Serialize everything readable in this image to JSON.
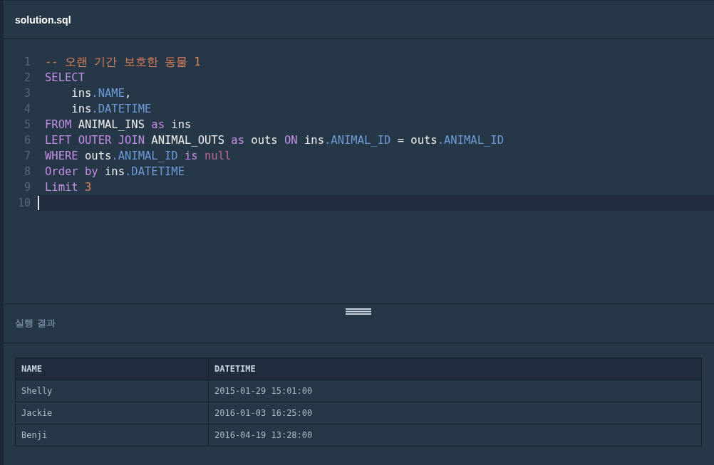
{
  "editor": {
    "filename": "solution.sql",
    "lines": [
      {
        "number": "1",
        "current": false,
        "tokens": [
          {
            "kind": "comment",
            "text": "-- 오랜 기간 보호한 동물 "
          },
          {
            "kind": "number",
            "text": "1"
          }
        ]
      },
      {
        "number": "2",
        "current": false,
        "tokens": [
          {
            "kind": "keyword",
            "text": "SELECT"
          }
        ]
      },
      {
        "number": "3",
        "current": false,
        "tokens": [
          {
            "kind": "plain",
            "text": "    ins"
          },
          {
            "kind": "property",
            "text": ".NAME"
          },
          {
            "kind": "plain",
            "text": ","
          }
        ]
      },
      {
        "number": "4",
        "current": false,
        "tokens": [
          {
            "kind": "plain",
            "text": "    ins"
          },
          {
            "kind": "property",
            "text": ".DATETIME"
          }
        ]
      },
      {
        "number": "5",
        "current": false,
        "tokens": [
          {
            "kind": "keyword",
            "text": "FROM"
          },
          {
            "kind": "plain",
            "text": " ANIMAL_INS "
          },
          {
            "kind": "keyword",
            "text": "as"
          },
          {
            "kind": "plain",
            "text": " ins"
          }
        ]
      },
      {
        "number": "6",
        "current": false,
        "tokens": [
          {
            "kind": "keyword",
            "text": "LEFT OUTER JOIN"
          },
          {
            "kind": "plain",
            "text": " ANIMAL_OUTS "
          },
          {
            "kind": "keyword",
            "text": "as"
          },
          {
            "kind": "plain",
            "text": " outs "
          },
          {
            "kind": "keyword",
            "text": "ON"
          },
          {
            "kind": "plain",
            "text": " ins"
          },
          {
            "kind": "property",
            "text": ".ANIMAL_ID"
          },
          {
            "kind": "plain",
            "text": " = outs"
          },
          {
            "kind": "property",
            "text": ".ANIMAL_ID"
          }
        ]
      },
      {
        "number": "7",
        "current": false,
        "tokens": [
          {
            "kind": "keyword",
            "text": "WHERE"
          },
          {
            "kind": "plain",
            "text": " outs"
          },
          {
            "kind": "property",
            "text": ".ANIMAL_ID "
          },
          {
            "kind": "keyword",
            "text": "is "
          },
          {
            "kind": "literal",
            "text": "null"
          }
        ]
      },
      {
        "number": "8",
        "current": false,
        "tokens": [
          {
            "kind": "keyword",
            "text": "Order by"
          },
          {
            "kind": "plain",
            "text": " ins"
          },
          {
            "kind": "property",
            "text": ".DATETIME"
          }
        ]
      },
      {
        "number": "9",
        "current": false,
        "tokens": [
          {
            "kind": "keyword",
            "text": "Limit "
          },
          {
            "kind": "number",
            "text": "3"
          }
        ]
      },
      {
        "number": "10",
        "current": true
      }
    ]
  },
  "results": {
    "title": "실행 결과",
    "columns": [
      "NAME",
      "DATETIME"
    ],
    "rows": [
      [
        "Shelly",
        "2015-01-29 15:01:00"
      ],
      [
        "Jackie",
        "2016-01-03 16:25:00"
      ],
      [
        "Benji",
        "2016-04-19 13:28:00"
      ]
    ]
  }
}
